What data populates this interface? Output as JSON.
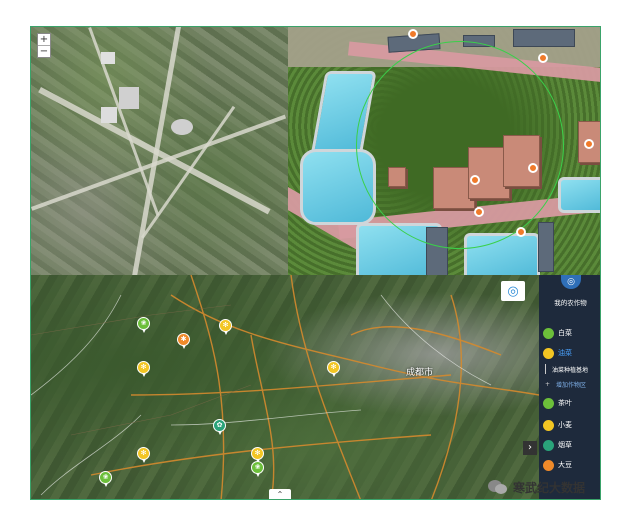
{
  "zoom": {
    "plus": "+",
    "minus": "−"
  },
  "sat_labels": [
    "",
    "",
    "",
    ""
  ],
  "legend": {
    "title": "我的农作物",
    "items": [
      {
        "label": "白菜",
        "color": "#6cbf3a",
        "active": false
      },
      {
        "label": "油菜",
        "color": "#f3c623",
        "active": true
      }
    ],
    "subs": [
      {
        "label": "油菜种植基地"
      },
      {
        "label": "增加作物区"
      }
    ],
    "items2": [
      {
        "label": "茶叶",
        "color": "#6cbf3a"
      },
      {
        "label": "小麦",
        "color": "#f3c623"
      },
      {
        "label": "烟草",
        "color": "#2aa37a"
      },
      {
        "label": "大豆",
        "color": "#ef8a2a"
      }
    ]
  },
  "map": {
    "city": "成都市"
  },
  "watermark": "寒武纪大数据"
}
